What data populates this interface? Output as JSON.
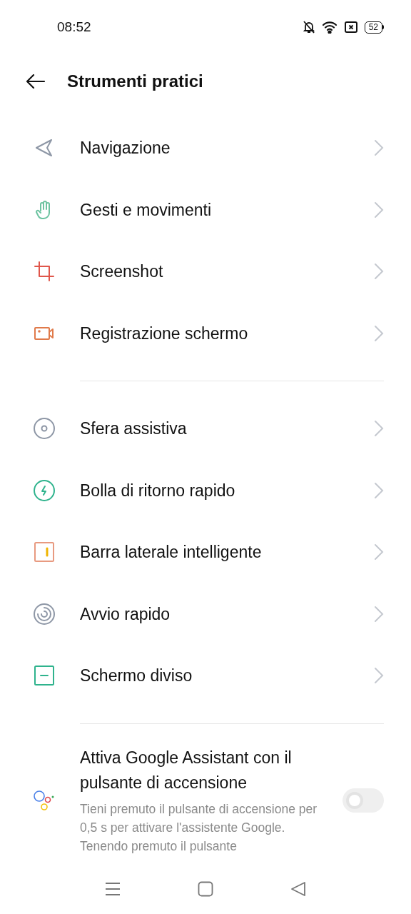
{
  "status_bar": {
    "time": "08:52",
    "battery": "52"
  },
  "header": {
    "title": "Strumenti pratici"
  },
  "groups": [
    {
      "items": [
        {
          "label": "Navigazione",
          "kind": "navigation"
        },
        {
          "label": "Gesti e movimenti",
          "kind": "hand"
        },
        {
          "label": "Screenshot",
          "kind": "crop"
        },
        {
          "label": "Registrazione schermo",
          "kind": "record"
        }
      ]
    },
    {
      "items": [
        {
          "label": "Sfera assistiva",
          "kind": "ball"
        },
        {
          "label": "Bolla di ritorno rapido",
          "kind": "bubble"
        },
        {
          "label": "Barra laterale intelligente",
          "kind": "sidebar"
        },
        {
          "label": "Avvio rapido",
          "kind": "spiral"
        },
        {
          "label": "Schermo diviso",
          "kind": "split"
        }
      ]
    }
  ],
  "assistant_setting": {
    "title": "Attiva Google Assistant con il pulsante di accensione",
    "description": "Tieni premuto il pulsante di accensione per 0,5 s per attivare l'assistente Google. Tenendo premuto il pulsante",
    "on": false
  }
}
